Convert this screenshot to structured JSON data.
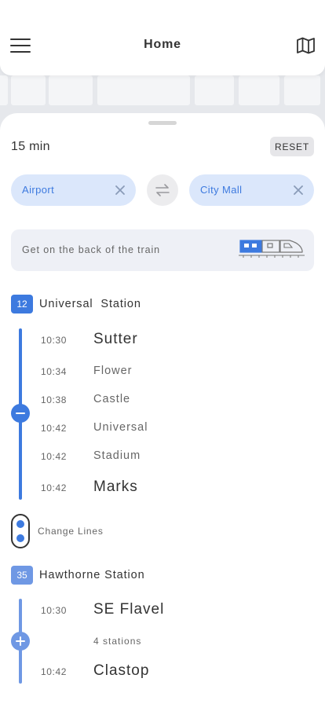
{
  "header": {
    "title": "Home",
    "menu_icon": "hamburger-menu-icon",
    "map_icon": "map-icon"
  },
  "trip": {
    "duration": "15 min",
    "reset_label": "RESET",
    "origin": "Airport",
    "destination": "City Mall",
    "tip": "Get on the back of the train"
  },
  "colors": {
    "primary": "#3d7adf",
    "secondary": "#6f98e4",
    "pill_bg": "#dbe7fb"
  },
  "segments": [
    {
      "line_number": "12",
      "station": "Universal  Station",
      "stops": [
        {
          "time": "10:30",
          "name": "Sutter"
        },
        {
          "time": "10:34",
          "name": "Flower"
        },
        {
          "time": "10:38",
          "name": "Castle"
        },
        {
          "time": "10:42",
          "name": "Universal"
        },
        {
          "time": "10:42",
          "name": "Stadium"
        },
        {
          "time": "10:42",
          "name": "Marks"
        }
      ]
    },
    {
      "line_number": "35",
      "station": "Hawthorne Station",
      "collapsed_label": "4 stations",
      "stops": [
        {
          "time": "10:30",
          "name": "SE Flavel"
        },
        {
          "time": "10:42",
          "name": "Clastop"
        }
      ]
    }
  ],
  "transfer": {
    "label": "Change Lines"
  }
}
